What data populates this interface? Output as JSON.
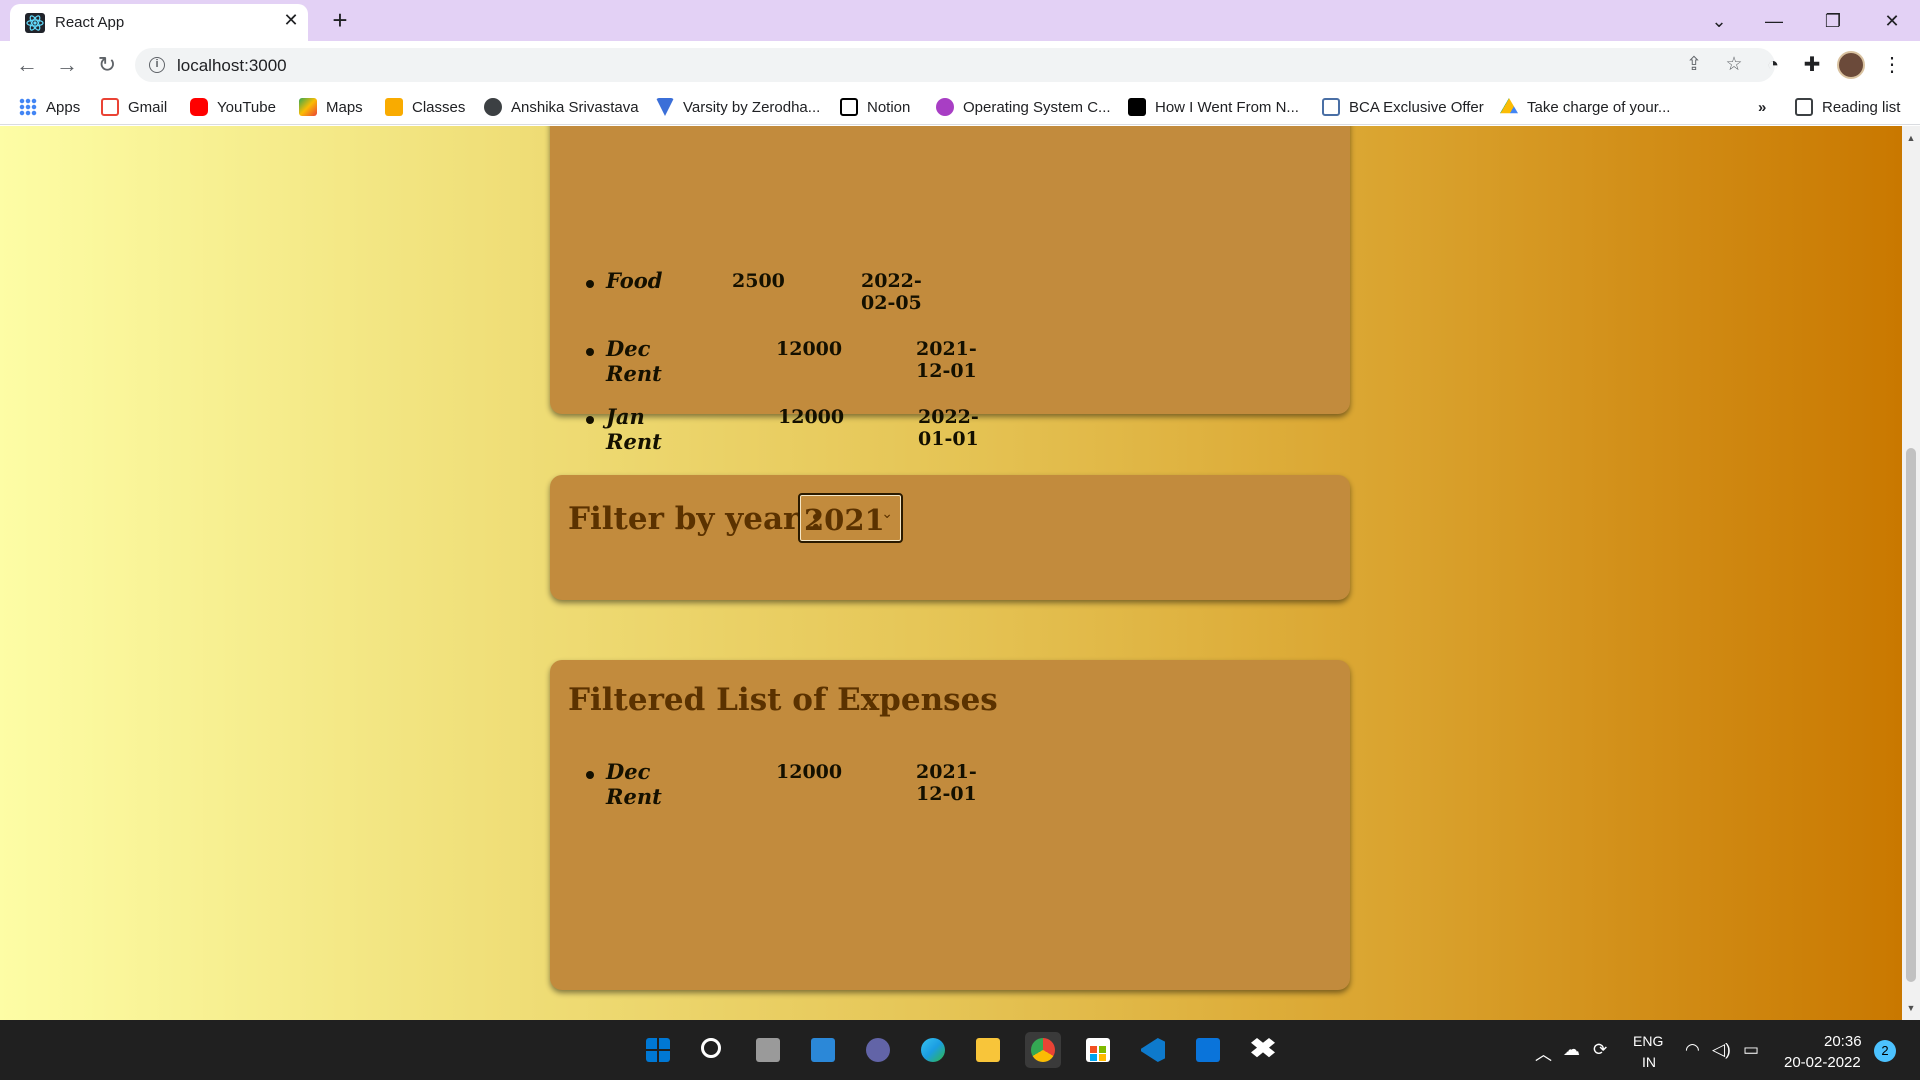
{
  "browser": {
    "tab_title": "React App",
    "url": "localhost:3000",
    "reading_list": "Reading list",
    "bookmarks_overflow": "»",
    "bookmarks": [
      {
        "label": "Apps",
        "icon": "apps-grid-icon",
        "color": "#4285f4"
      },
      {
        "label": "Gmail",
        "icon": "gmail-icon",
        "color": "#ea4335"
      },
      {
        "label": "YouTube",
        "icon": "youtube-icon",
        "color": "#ff0000"
      },
      {
        "label": "Maps",
        "icon": "maps-icon",
        "color": "#34a853"
      },
      {
        "label": "Classes",
        "icon": "classroom-icon",
        "color": "#f9ab00"
      },
      {
        "label": "Anshika Srivastava",
        "icon": "globe-icon",
        "color": "#3c4043"
      },
      {
        "label": "Varsity by Zerodha...",
        "icon": "varsity-icon",
        "color": "#3b6fd8"
      },
      {
        "label": "Notion",
        "icon": "notion-icon",
        "color": "#000000"
      },
      {
        "label": "Operating System C...",
        "icon": "operating-system-icon",
        "color": "#a83ec4"
      },
      {
        "label": "How I Went From N...",
        "icon": "medium-icon",
        "color": "#000000"
      },
      {
        "label": "BCA Exclusive Offer",
        "icon": "bca-offer-icon",
        "color": "#4a6fa5"
      },
      {
        "label": "Take charge of your...",
        "icon": "google-drive-icon",
        "color": "#fbbc04"
      }
    ]
  },
  "page": {
    "all_expenses": [
      {
        "title": "Food",
        "amount": "2500",
        "date": "2022-02-05"
      },
      {
        "title": "Dec Rent",
        "amount": "12000",
        "date": "2021-12-01"
      },
      {
        "title": "Jan Rent",
        "amount": "12000",
        "date": "2022-01-01"
      }
    ],
    "filter_label": "Filter by year :",
    "filter_value": "2021",
    "filtered_title": "Filtered List of Expenses",
    "filtered_expenses": [
      {
        "title": "Dec Rent",
        "amount": "12000",
        "date": "2021-12-01"
      }
    ],
    "colors": {
      "card": "#c28b3d",
      "heading": "#5b3200",
      "gradient_start": "#fdfda5",
      "gradient_end": "#c97800"
    }
  },
  "taskbar": {
    "lang_line1": "ENG",
    "lang_line2": "IN",
    "time": "20:36",
    "date": "20-02-2022",
    "notification_count": "2",
    "apps": [
      "windows-start-icon",
      "search-icon",
      "task-view-icon",
      "widgets-icon",
      "teams-chat-icon",
      "edge-icon",
      "file-explorer-icon",
      "chrome-icon",
      "microsoft-store-icon",
      "vscode-icon",
      "mail-icon",
      "dropbox-icon"
    ]
  }
}
